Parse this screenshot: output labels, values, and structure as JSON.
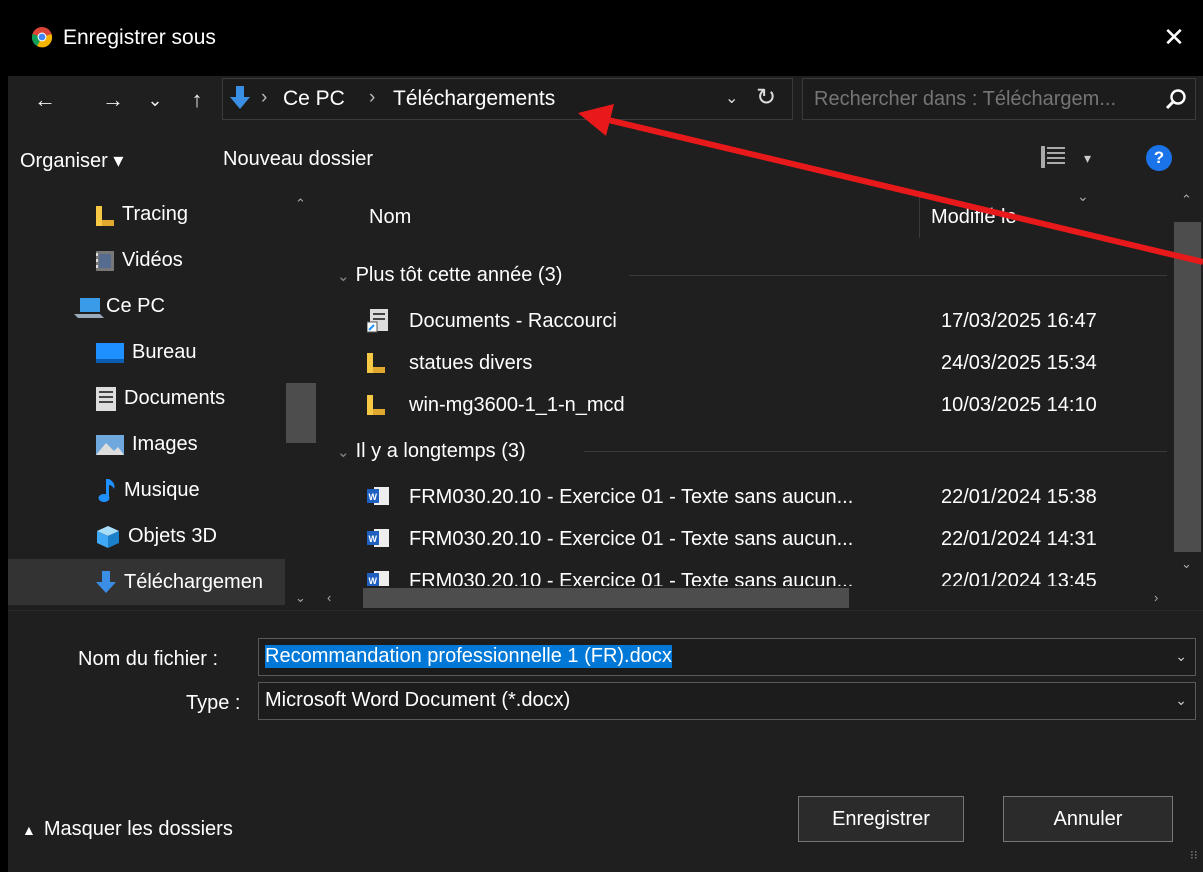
{
  "window": {
    "title": "Enregistrer sous",
    "close_glyph": "✕",
    "app_icon": "chrome-icon"
  },
  "nav": {
    "back_glyph": "←",
    "forward_glyph": "→",
    "recent_glyph": "⌄",
    "up_glyph": "↑",
    "breadcrumbs": [
      "Ce PC",
      "Téléchargements"
    ],
    "separator": "›",
    "dropdown_glyph": "⌄",
    "refresh_glyph": "↻"
  },
  "search": {
    "placeholder": "Rechercher dans : Téléchargem..."
  },
  "toolbar": {
    "organize_label": "Organiser ▾",
    "new_folder_label": "Nouveau dossier",
    "view_dropdown_glyph": "▾",
    "help_label": "?"
  },
  "sidebar": {
    "items": [
      {
        "label": "Tracing",
        "icon": "folder-icon"
      },
      {
        "label": "Vidéos",
        "icon": "videos-icon"
      },
      {
        "label": "Ce PC",
        "icon": "computer-icon"
      },
      {
        "label": "Bureau",
        "icon": "desktop-icon"
      },
      {
        "label": "Documents",
        "icon": "documents-icon"
      },
      {
        "label": "Images",
        "icon": "images-icon"
      },
      {
        "label": "Musique",
        "icon": "music-icon"
      },
      {
        "label": "Objets 3D",
        "icon": "objects3d-icon"
      },
      {
        "label": "Téléchargemen",
        "icon": "downloads-icon"
      }
    ]
  },
  "list": {
    "columns": [
      "Nom",
      "Modifié le"
    ],
    "groups": [
      {
        "label": "Plus tôt cette année (3)",
        "rows": [
          {
            "name": "Documents - Raccourci",
            "date": "17/03/2025 16:47",
            "icon": "shortcut-icon"
          },
          {
            "name": "statues divers",
            "date": "24/03/2025 15:34",
            "icon": "folder-icon"
          },
          {
            "name": "win-mg3600-1_1-n_mcd",
            "date": "10/03/2025 14:10",
            "icon": "folder-icon"
          }
        ]
      },
      {
        "label": "Il y a longtemps (3)",
        "rows": [
          {
            "name": "FRM030.20.10 - Exercice 01 - Texte sans aucun...",
            "date": "22/01/2024 15:38",
            "icon": "word-icon"
          },
          {
            "name": "FRM030.20.10 - Exercice 01 - Texte sans aucun...",
            "date": "22/01/2024 14:31",
            "icon": "word-icon"
          },
          {
            "name": "FRM030.20.10 - Exercice 01 - Texte sans aucun...",
            "date": "22/01/2024 13:45",
            "icon": "word-icon"
          }
        ]
      }
    ]
  },
  "form": {
    "filename_label": "Nom du fichier :",
    "filename_value": "Recommandation professionnelle 1 (FR).docx",
    "type_label": "Type :",
    "type_value": "Microsoft Word Document (*.docx)"
  },
  "footer": {
    "hide_folders_label": "Masquer les dossiers",
    "save_label": "Enregistrer",
    "cancel_label": "Annuler"
  },
  "colors": {
    "accent": "#0078d7",
    "annotation_arrow": "#e8191a",
    "help": "#1a73e8"
  }
}
